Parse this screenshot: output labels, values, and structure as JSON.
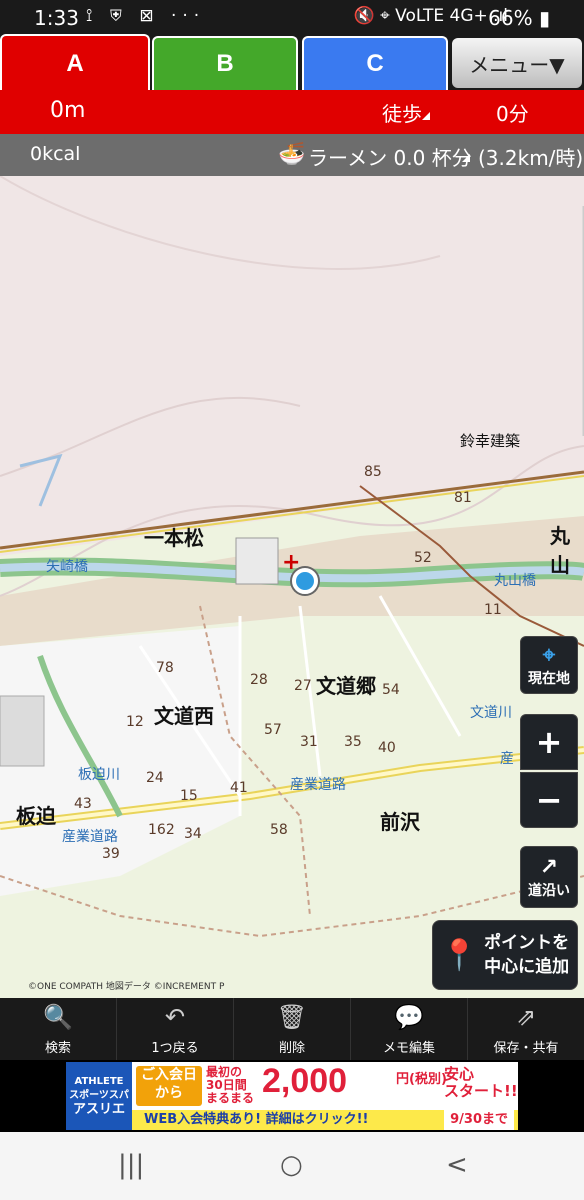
{
  "status": {
    "time": "1:33",
    "icons": "⟟ ⛨ ⊠  ···",
    "signal": "🔇 ⌖ VoLTE 4G+ .ıl",
    "battery": "66% ▮"
  },
  "tabs": {
    "a": "A",
    "b": "B",
    "c": "C",
    "menu": "メニュー▼"
  },
  "route": {
    "distance": "0m",
    "mode": "徒歩",
    "time": "0分"
  },
  "stats": {
    "kcal": "0kcal",
    "ramen": "ラーメン 0.0 杯分",
    "speed": "(3.2km/時)"
  },
  "map": {
    "places": [
      "丸山",
      "一本松",
      "文道郷",
      "文道西",
      "板迫",
      "前沢",
      "丸山",
      "鈴幸建築"
    ],
    "water": [
      "矢崎橋",
      "丸山橋",
      "文道川",
      "板迫川"
    ],
    "roads": [
      "産業道路",
      "産業道路",
      "産"
    ],
    "numbers": [
      "85",
      "81",
      "52",
      "11",
      "78",
      "28",
      "27",
      "54",
      "12",
      "57",
      "31",
      "35",
      "40",
      "24",
      "15",
      "41",
      "43",
      "162",
      "34",
      "58",
      "39"
    ],
    "copyright": "©ONE COMPATH 地図データ ©INCREMENT P"
  },
  "mapbuttons": {
    "genzai": "現在地",
    "zoomin": "+",
    "zoomout": "−",
    "michi": "道沿い",
    "addpoint1": "ポイントを",
    "addpoint2": "中心に追加"
  },
  "toolbar": [
    {
      "label": "検索",
      "icon": "search-icon"
    },
    {
      "label": "1つ戻る",
      "icon": "undo-icon"
    },
    {
      "label": "削除",
      "icon": "trash-icon"
    },
    {
      "label": "メモ編集",
      "icon": "memo-icon"
    },
    {
      "label": "保存・共有",
      "icon": "share-icon"
    }
  ],
  "ad": {
    "brand1": "ATHLETE",
    "brand2": "スポーツスパ",
    "brand3": "アスリエ",
    "join1": "ご入会日",
    "join2": "から",
    "first1": "最初の",
    "first2": "30日間",
    "first3": "まるまる",
    "price": "2,000",
    "unit": "円(税別)",
    "start1": "安心",
    "start2": "スタート!!",
    "bottom": "WEB入会特典あり! 詳細はクリック!!",
    "date": "9/30まで"
  },
  "navbar": {
    "recent": "|||",
    "home": "○",
    "back": "<"
  }
}
